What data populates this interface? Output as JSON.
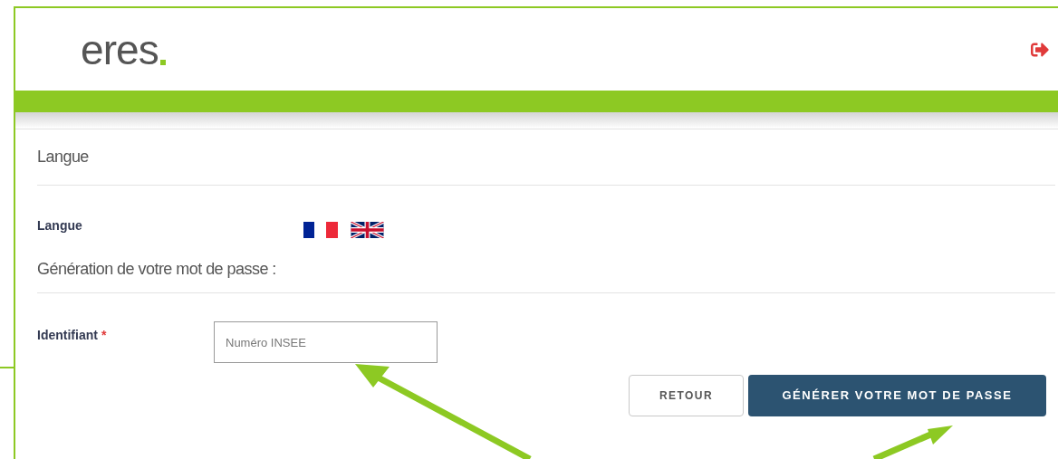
{
  "header": {
    "logo": "eres"
  },
  "language_section": {
    "title": "Langue",
    "label": "Langue",
    "flags": [
      {
        "kind": "fr"
      },
      {
        "kind": "gb"
      }
    ]
  },
  "password_section": {
    "title": "Génération de votre mot de passe :",
    "field": {
      "label": "Identifiant",
      "required_mark": "*",
      "placeholder": "Numéro INSEE"
    }
  },
  "buttons": [
    {
      "kind": "secondary",
      "label": "RETOUR"
    },
    {
      "kind": "primary",
      "label": "GÉNÉRER VOTRE MOT DE PASSE"
    }
  ]
}
